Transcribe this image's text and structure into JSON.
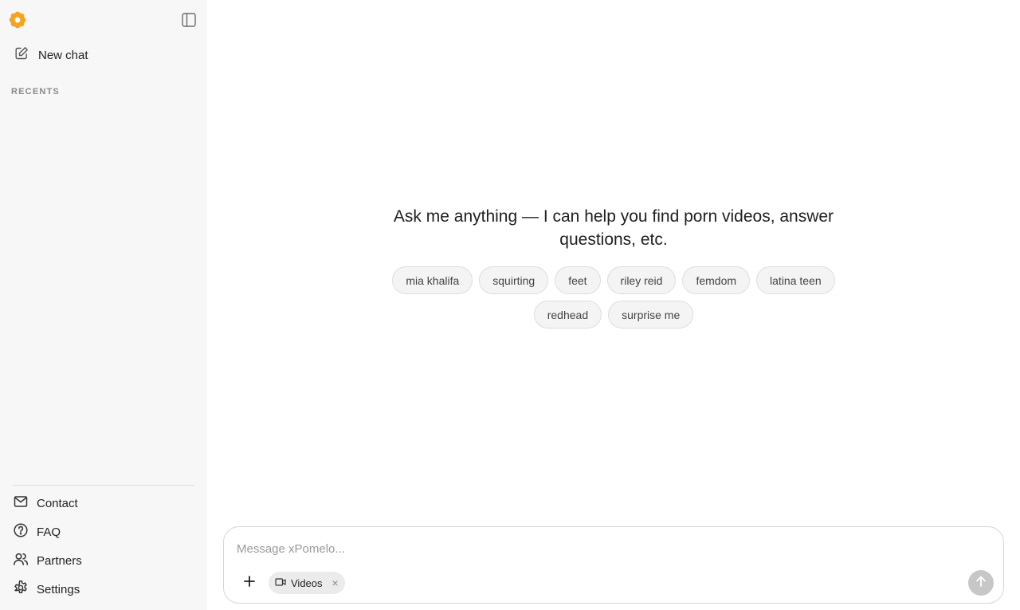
{
  "sidebar": {
    "logo_icon": "flower-logo-icon",
    "toggle_icon": "sidebar-toggle-icon",
    "new_chat_label": "New chat",
    "recents_label": "RECENTS",
    "footer_items": [
      {
        "label": "Contact",
        "icon": "mail-icon"
      },
      {
        "label": "FAQ",
        "icon": "help-circle-icon"
      },
      {
        "label": "Partners",
        "icon": "users-icon"
      },
      {
        "label": "Settings",
        "icon": "gear-icon"
      }
    ]
  },
  "main": {
    "headline": "Ask me anything — I can help you find porn videos, answer questions, etc.",
    "suggestions": [
      "mia khalifa",
      "squirting",
      "feet",
      "riley reid",
      "femdom",
      "latina teen",
      "redhead",
      "surprise me"
    ]
  },
  "composer": {
    "placeholder": "Message xPomelo...",
    "value": "",
    "mode_pill_label": "Videos",
    "mode_pill_icon": "video-icon",
    "send_icon": "arrow-up-icon"
  },
  "colors": {
    "accent": "#f5a41d",
    "sidebar_bg": "#f7f7f7",
    "chip_bg": "#f4f4f4",
    "send_disabled": "#c7c7c7"
  }
}
